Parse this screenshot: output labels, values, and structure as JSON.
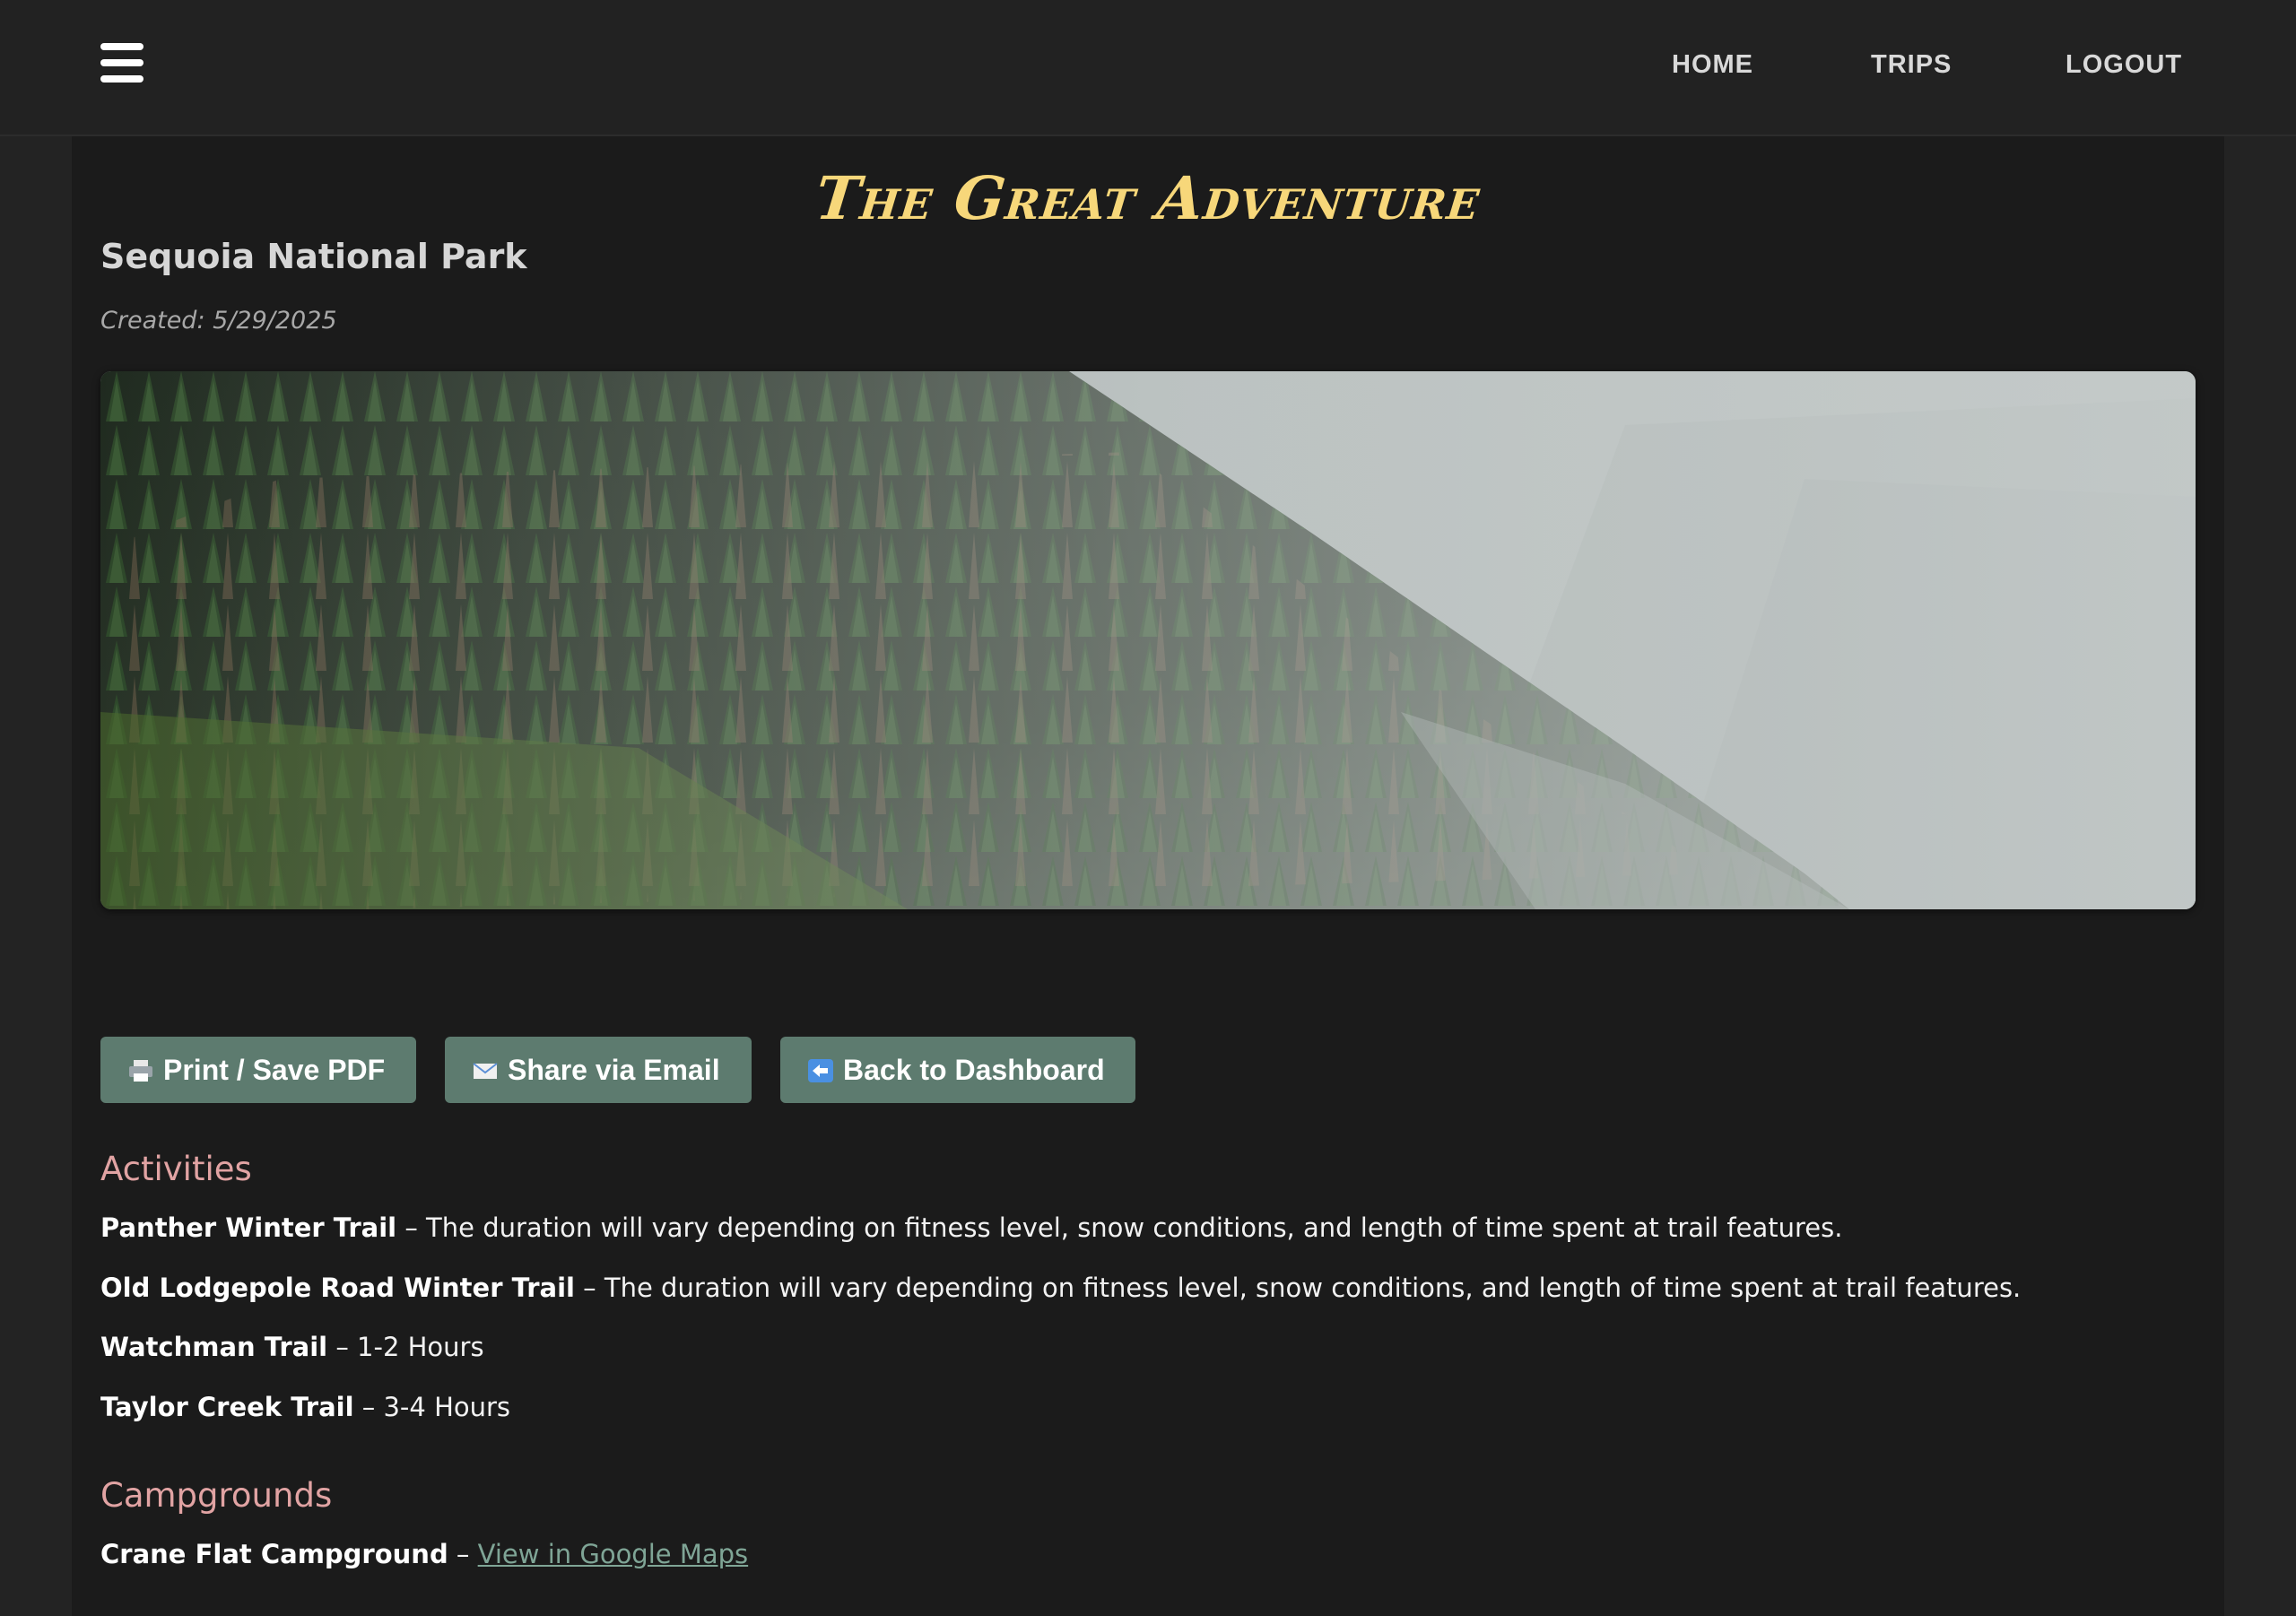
{
  "nav": {
    "menu_icon": "hamburger-menu-icon",
    "links": [
      "HOME",
      "TRIPS",
      "LOGOUT"
    ]
  },
  "header": {
    "title": "The Great Adventure",
    "park_name": "Sequoia National Park",
    "created": "Created: 5/29/2025"
  },
  "hero_image": {
    "subject": "forested mountain slope with misty valley",
    "icon": "hero-photo"
  },
  "actions": {
    "print_label": "Print / Save PDF",
    "print_icon": "printer-icon",
    "share_label": "Share via Email",
    "share_icon": "email-icon",
    "back_label": "Back to Dashboard",
    "back_icon": "back-arrow-icon"
  },
  "activities": {
    "heading": "Activities",
    "items": [
      {
        "name": "Panther Winter Trail",
        "detail": " – The duration will vary depending on fitness level, snow conditions, and length of time spent at trail features."
      },
      {
        "name": "Old Lodgepole Road Winter Trail",
        "detail": " – The duration will vary depending on fitness level, snow conditions, and length of time spent at trail features."
      },
      {
        "name": "Watchman Trail",
        "detail": " – 1-2 Hours"
      },
      {
        "name": "Taylor Creek Trail",
        "detail": " – 3-4 Hours"
      }
    ]
  },
  "campgrounds": {
    "heading": "Campgrounds",
    "items": [
      {
        "name": "Crane Flat Campground",
        "separator": " – ",
        "link_text": "View in Google Maps"
      }
    ]
  },
  "colors": {
    "title": "#f7d77a",
    "section_heading": "#e1a3a3",
    "button_bg": "#5d7b6f",
    "link": "#7fa596",
    "page_bg": "#1b1b1b",
    "nav_bg": "#222222"
  }
}
